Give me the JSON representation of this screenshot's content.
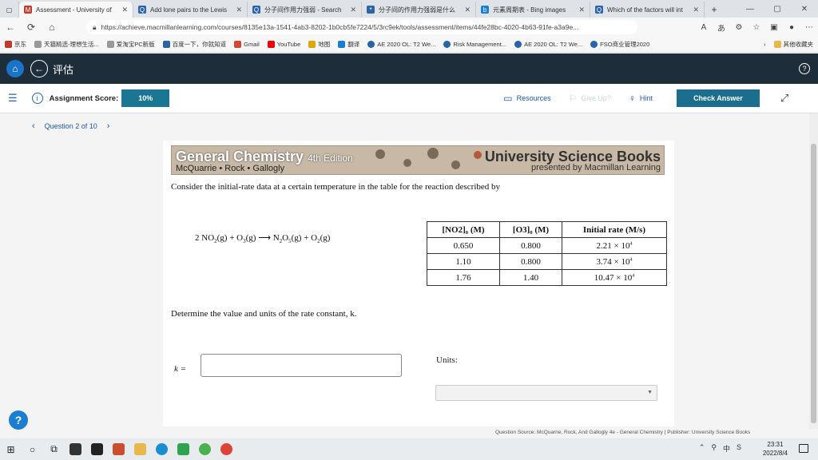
{
  "browser": {
    "tabs": [
      {
        "title": "Assessment - University of",
        "icon_color": "#c0392b",
        "active": true
      },
      {
        "title": "Add lone pairs to the Lewis",
        "icon_color": "#2a64a8",
        "active": false
      },
      {
        "title": "分子间作用力强弱 - Search",
        "icon_color": "#2a64a8",
        "active": false
      },
      {
        "title": "分子间的作用力强弱是什么",
        "icon_color": "#2a64a8",
        "active": false
      },
      {
        "title": "元素周期表 - Bing images",
        "icon_color": "#2a64a8",
        "active": false
      },
      {
        "title": "Which of the factors will int",
        "icon_color": "#2a64a8",
        "active": false
      }
    ],
    "url": "https://achieve.macmillanlearning.com/courses/8135e13a-1541-4ab3-8202-1b0cb5fe7224/5/3rc9ek/tools/assessment/items/44fe28bc-4020-4b63-91fe-a3a9e...",
    "bookmarks": [
      "京东",
      "天猫精选-理想生活...",
      "爱淘宝PC新版",
      "百度一下，你就知道",
      "Gmail",
      "YouTube",
      "地图",
      "翻译",
      "AE 2020 OL: T2 We...",
      "Risk Management...",
      "AE 2020 OL: T2 We...",
      "FSO商业管理2020"
    ],
    "bookmarks_other": "其他收藏夹"
  },
  "app": {
    "title": "评估",
    "score_label": "Assignment Score:",
    "score_value": "10%",
    "resources_label": "Resources",
    "giveup_label": "Give Up?",
    "hint_label": "Hint",
    "check_label": "Check Answer",
    "question_nav": "Question 2 of 10"
  },
  "question": {
    "banner_title": "General Chemistry",
    "banner_edition": "4th Edition",
    "banner_authors": "McQuarrie • Rock • Gallogly",
    "banner_publisher": "University Science Books",
    "banner_presented": "presented by Macmillan Learning",
    "prompt": "Consider the initial-rate data at a certain temperature in the table for the reaction described by",
    "reaction": {
      "r1": "2 NO",
      "r1s": "2",
      "r1p": "(g) + O",
      "r2s": "3",
      "r2p": "(g) ⟶ N",
      "p1s": "2",
      "p1m": "O",
      "p1s2": "5",
      "p1p": "(g) + O",
      "p2s": "2",
      "p2p": "(g)"
    },
    "table": {
      "headers": [
        "[NO2]₀ (M)",
        "[O3]₀ (M)",
        "Initial rate (M/s)"
      ],
      "rows": [
        {
          "no2": "0.650",
          "o3": "0.800",
          "rate": "2.21 × 10",
          "exp": "4"
        },
        {
          "no2": "1.10",
          "o3": "0.800",
          "rate": "3.74 × 10",
          "exp": "4"
        },
        {
          "no2": "1.76",
          "o3": "1.40",
          "rate": "10.47 × 10",
          "exp": "4"
        }
      ]
    },
    "determine": "Determine the value and units of the rate constant, k.",
    "k_label": "k =",
    "units_label": "Units:",
    "source": "Question Source: McQuarrie, Rock, And Gallogly 4e - General Chemistry  |  Publisher: University Science Books"
  },
  "taskbar": {
    "time": "23:31",
    "date": "2022/8/4",
    "lang": "中"
  }
}
